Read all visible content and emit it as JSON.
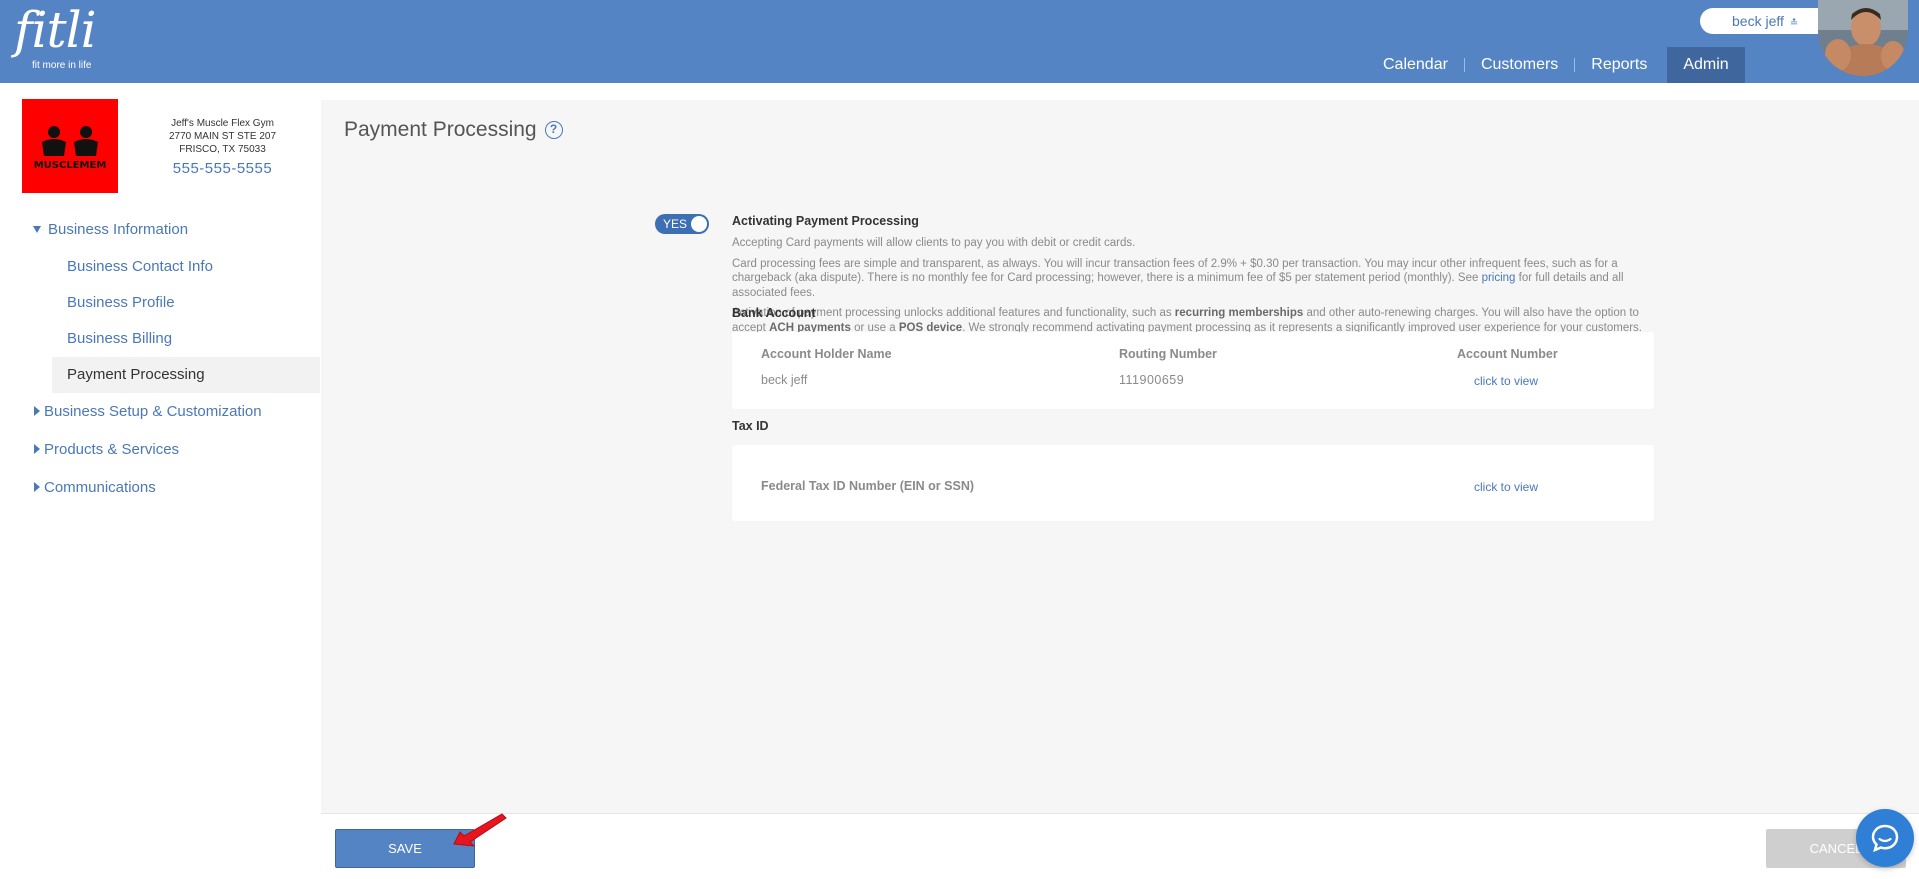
{
  "app": {
    "logo_text": "fitli",
    "logo_tagline": "fit more in life"
  },
  "header": {
    "user_name": "beck jeff",
    "nav": [
      {
        "label": "Calendar"
      },
      {
        "label": "Customers"
      },
      {
        "label": "Reports"
      },
      {
        "label": "Admin"
      }
    ],
    "active_nav": "Admin"
  },
  "business": {
    "logo_text": "MUSCLEMEM",
    "name": "Jeff's Muscle Flex Gym",
    "address_line1": "2770 MAIN ST STE 207",
    "address_line2": "FRISCO, TX 75033",
    "phone": "555-555-5555"
  },
  "sidebar": {
    "group_business_info": "Business Information",
    "sub_items": [
      "Business Contact Info",
      "Business Profile",
      "Business Billing",
      "Payment Processing"
    ],
    "group_setup": "Business Setup & Customization",
    "group_products": "Products & Services",
    "group_comms": "Communications"
  },
  "page": {
    "title": "Payment Processing",
    "toggle_label": "YES",
    "activating_title": "Activating Payment Processing",
    "para1": "Accepting Card payments will allow clients to pay you with debit or credit cards.",
    "para2_a": "Card processing fees are simple and transparent, as always. You will incur transaction fees of 2.9% + $0.30 per transaction. You may incur other infrequent fees, such as for a chargeback (aka dispute). There is no monthly fee for Card processing; however, there is a minimum fee of $5 per statement period (monthly). See ",
    "para2_link": "pricing",
    "para2_b": " for full details and all associated fees.",
    "para3_a": "Activation of payment processing unlocks additional features and functionality, such as ",
    "para3_b1": "recurring memberships",
    "para3_c": " and other auto-renewing charges. You will also have the option to accept ",
    "para3_b2": "ACH payments",
    "para3_d": " or use a ",
    "para3_b3": "POS device",
    "para3_e": ". We strongly recommend activating payment processing as it represents a significantly improved user experience for your customers.",
    "bank_title": "Bank Account",
    "bank": {
      "col_holder": "Account Holder Name",
      "col_routing": "Routing Number",
      "col_account": "Account Number",
      "holder": "beck jeff",
      "routing": "111900659",
      "account_link": "click to view"
    },
    "tax_title": "Tax ID",
    "tax": {
      "label": "Federal Tax ID Number (EIN or SSN)",
      "link": "click to view"
    }
  },
  "footer": {
    "save_label": "SAVE",
    "cancel_label": "CANCEL"
  },
  "colors": {
    "header_blue": "#5584c4",
    "active_nav": "#3f669d",
    "link_blue": "#4a78b8",
    "business_logo_bg": "#ff0000",
    "annotation_arrow": "#e8141e"
  }
}
